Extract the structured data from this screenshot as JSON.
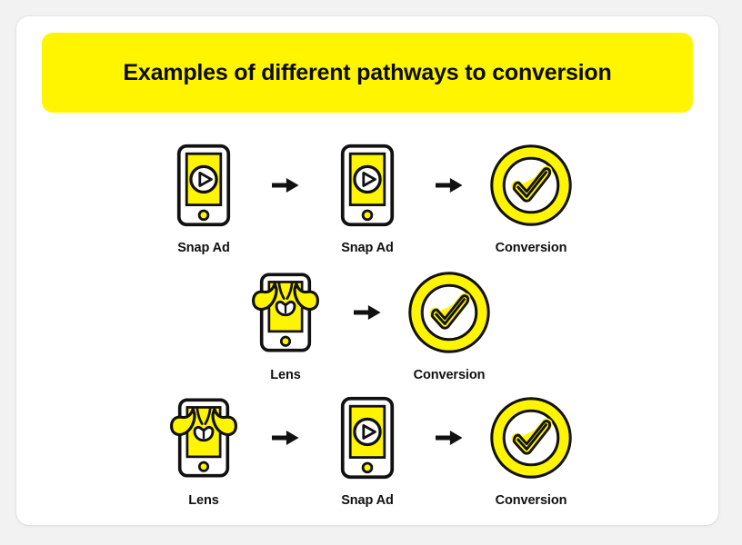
{
  "card": {
    "title": "Examples of different pathways to conversion",
    "background_color": "#ffffff",
    "banner_color": "#fff500"
  },
  "colors": {
    "snap_yellow": "#fff500",
    "outline_black": "#111111",
    "page_background": "#f2f2f2",
    "card_background": "#ffffff",
    "label_text": "#101010"
  },
  "pathways": [
    {
      "row_label": "pathway-1",
      "steps": [
        {
          "label": "Snap Ad",
          "icon": "phone-play-icon"
        },
        {
          "label": "Snap Ad",
          "icon": "phone-play-icon"
        },
        {
          "label": "Conversion",
          "icon": "conversion-check-icon"
        }
      ],
      "arrow": "arrow-right-icon"
    },
    {
      "row_label": "pathway-2",
      "steps": [
        {
          "label": "Lens",
          "icon": "phone-lens-dog-icon"
        },
        {
          "label": "Conversion",
          "icon": "conversion-check-icon"
        }
      ],
      "arrow": "arrow-right-icon"
    },
    {
      "row_label": "pathway-3",
      "steps": [
        {
          "label": "Lens",
          "icon": "phone-lens-dog-icon"
        },
        {
          "label": "Snap Ad",
          "icon": "phone-play-icon"
        },
        {
          "label": "Conversion",
          "icon": "conversion-check-icon"
        }
      ],
      "arrow": "arrow-right-icon"
    }
  ]
}
